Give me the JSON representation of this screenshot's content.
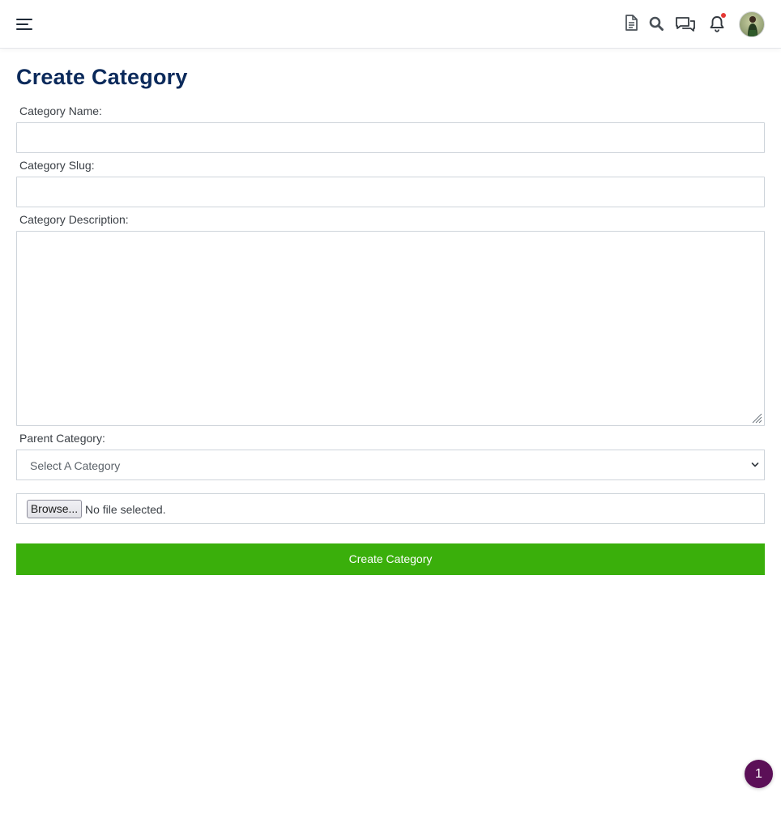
{
  "header": {
    "icons": [
      "menu-icon",
      "document-icon",
      "search-icon",
      "chat-icon",
      "bell-icon",
      "avatar"
    ],
    "notification_dot_color": "#e53935"
  },
  "page": {
    "title": "Create Category"
  },
  "form": {
    "name_label": "Category Name:",
    "name_value": "",
    "slug_label": "Category Slug:",
    "slug_value": "",
    "description_label": "Category Description:",
    "description_value": "",
    "parent_label": "Parent Category:",
    "parent_selected": "Select A Category",
    "browse_label": "Browse...",
    "file_status": "No file selected.",
    "submit_label": "Create Category"
  },
  "floating_badge": {
    "count": "1"
  },
  "colors": {
    "title": "#0b2a5b",
    "submit_bg": "#3aaf0b",
    "badge_bg": "#5b0f57"
  }
}
